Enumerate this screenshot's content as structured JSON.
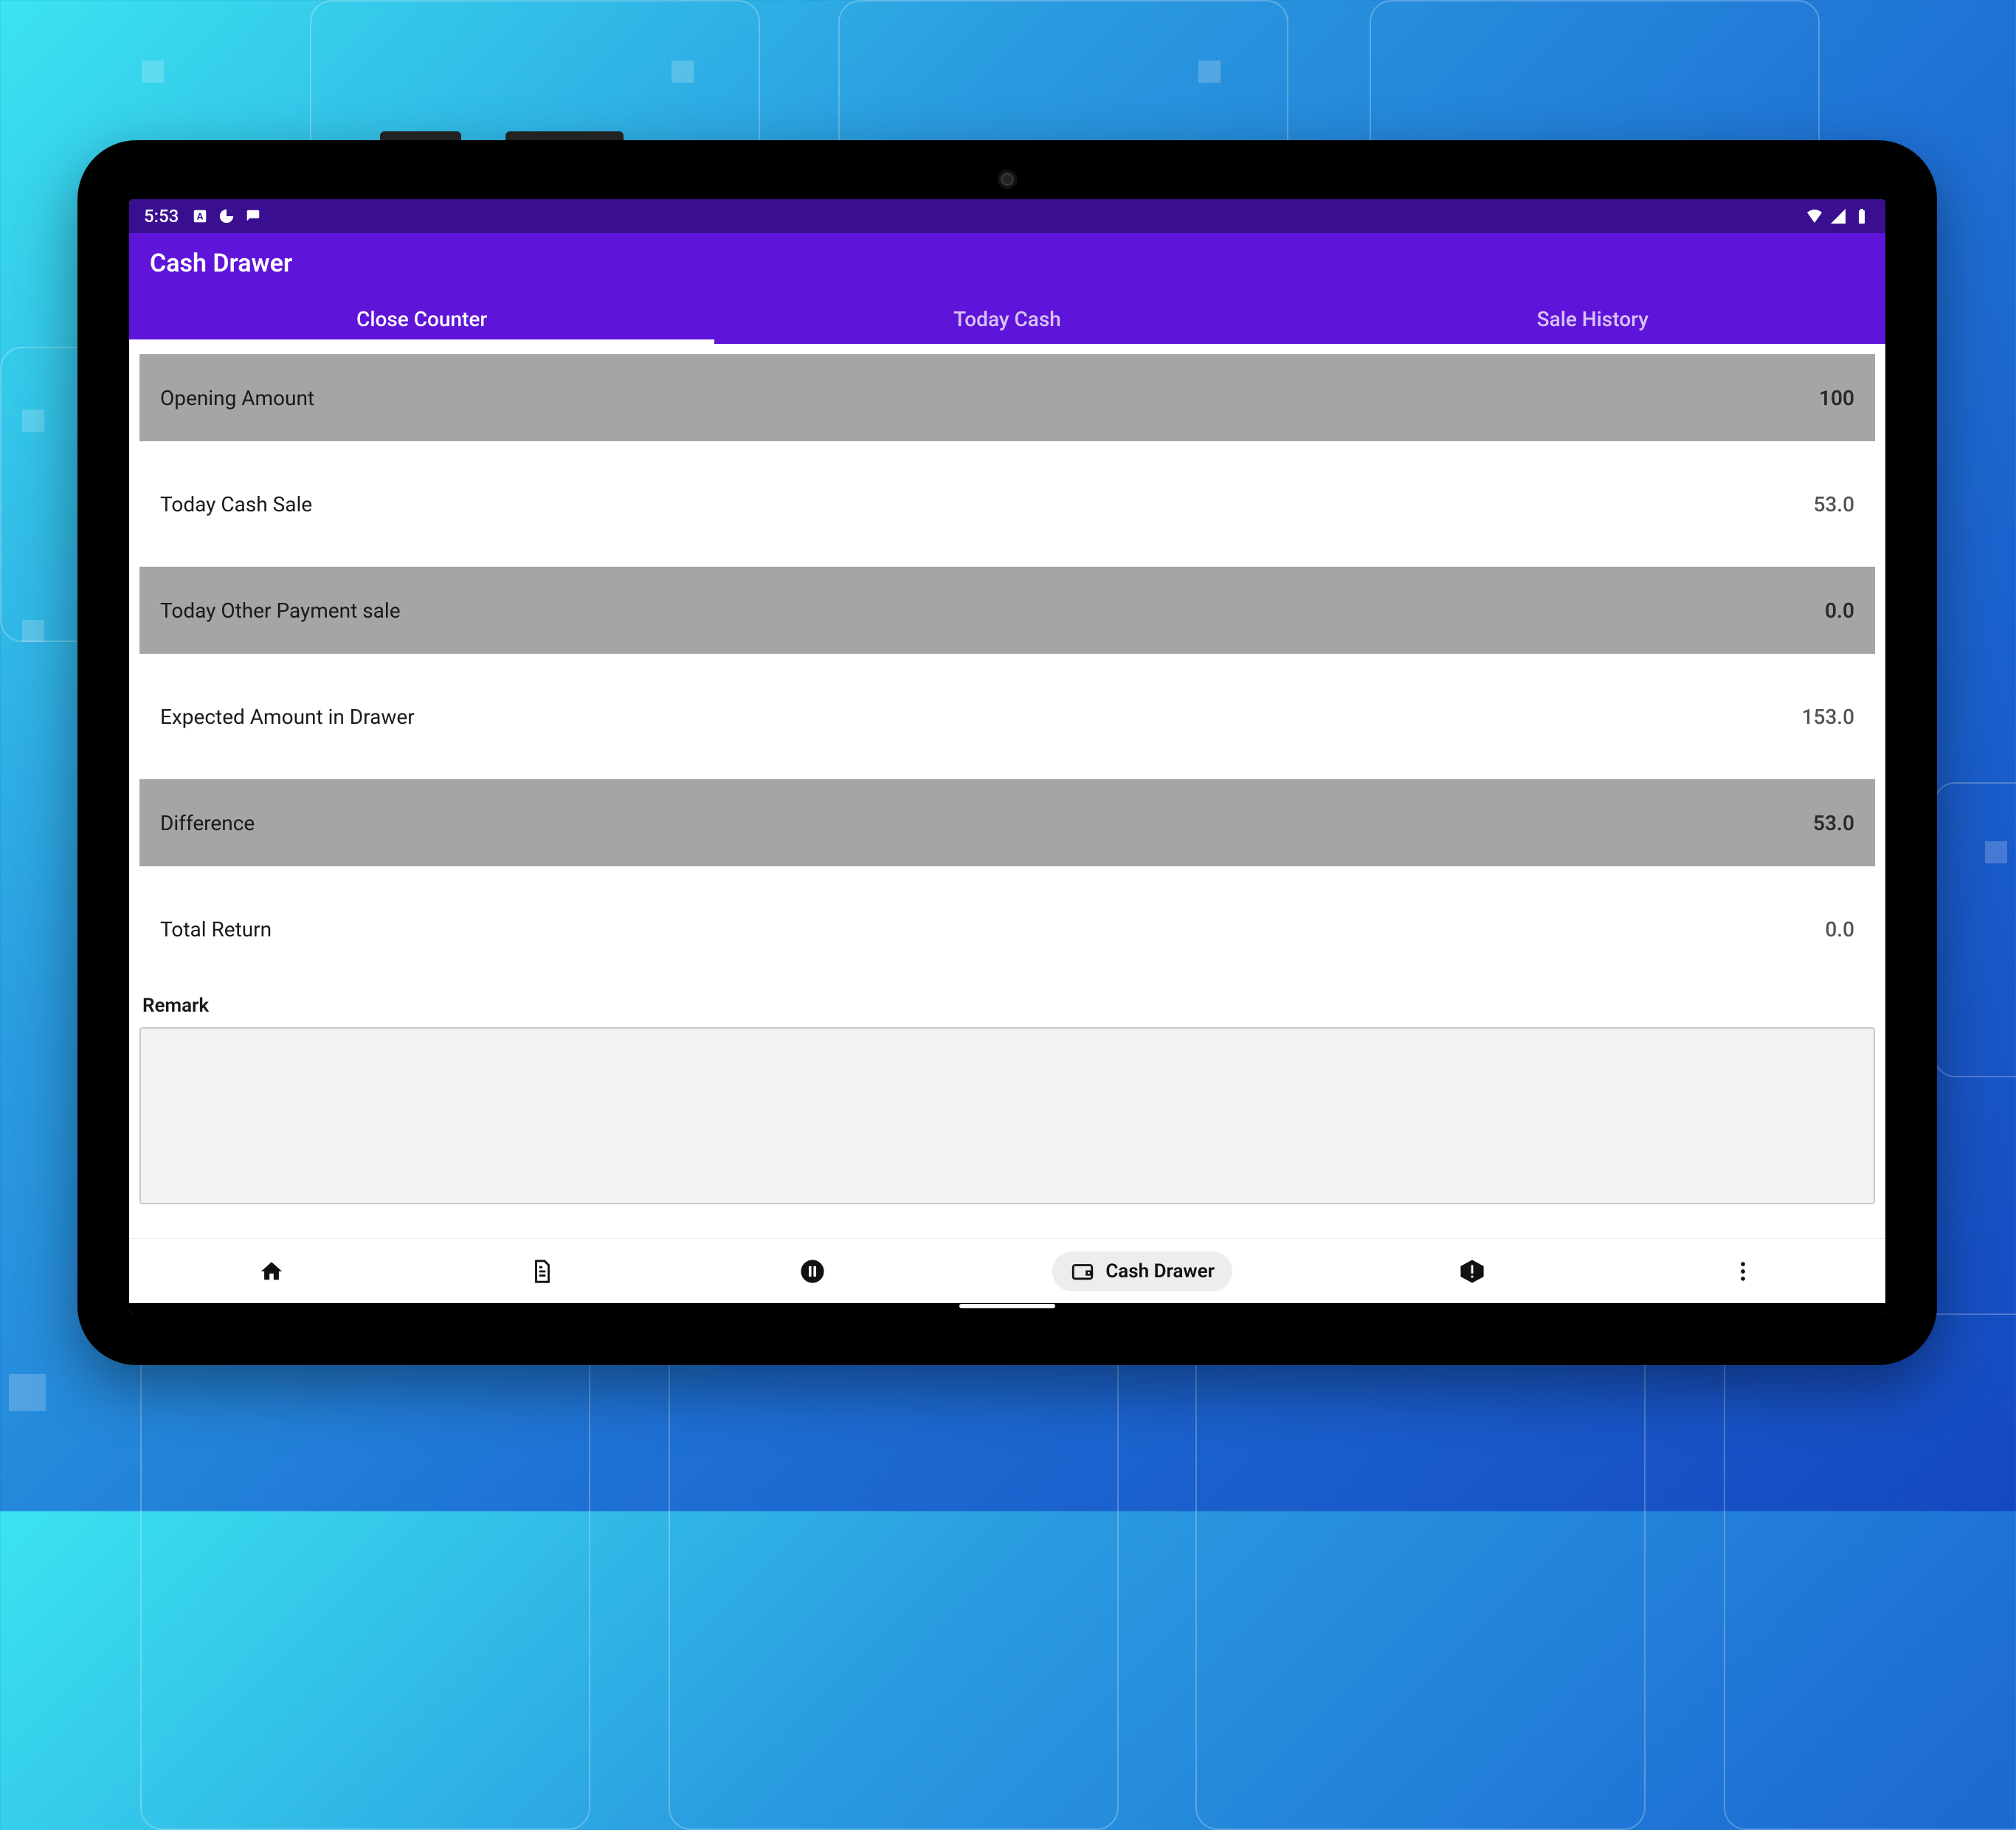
{
  "statusbar": {
    "time": "5:53"
  },
  "appbar": {
    "title": "Cash Drawer"
  },
  "tabs": {
    "t0": "Close Counter",
    "t1": "Today Cash",
    "t2": "Sale History"
  },
  "rows": {
    "opening": {
      "label": "Opening Amount",
      "value": "100"
    },
    "cashsale": {
      "label": "Today Cash Sale",
      "value": "53.0"
    },
    "other": {
      "label": "Today Other Payment sale",
      "value": "0.0"
    },
    "expected": {
      "label": "Expected Amount in Drawer",
      "value": "153.0"
    },
    "diff": {
      "label": "Difference",
      "value": "53.0"
    },
    "return": {
      "label": "Total Return",
      "value": "0.0"
    }
  },
  "remark": {
    "label": "Remark",
    "value": ""
  },
  "bottomnav": {
    "active_label": "Cash Drawer"
  }
}
